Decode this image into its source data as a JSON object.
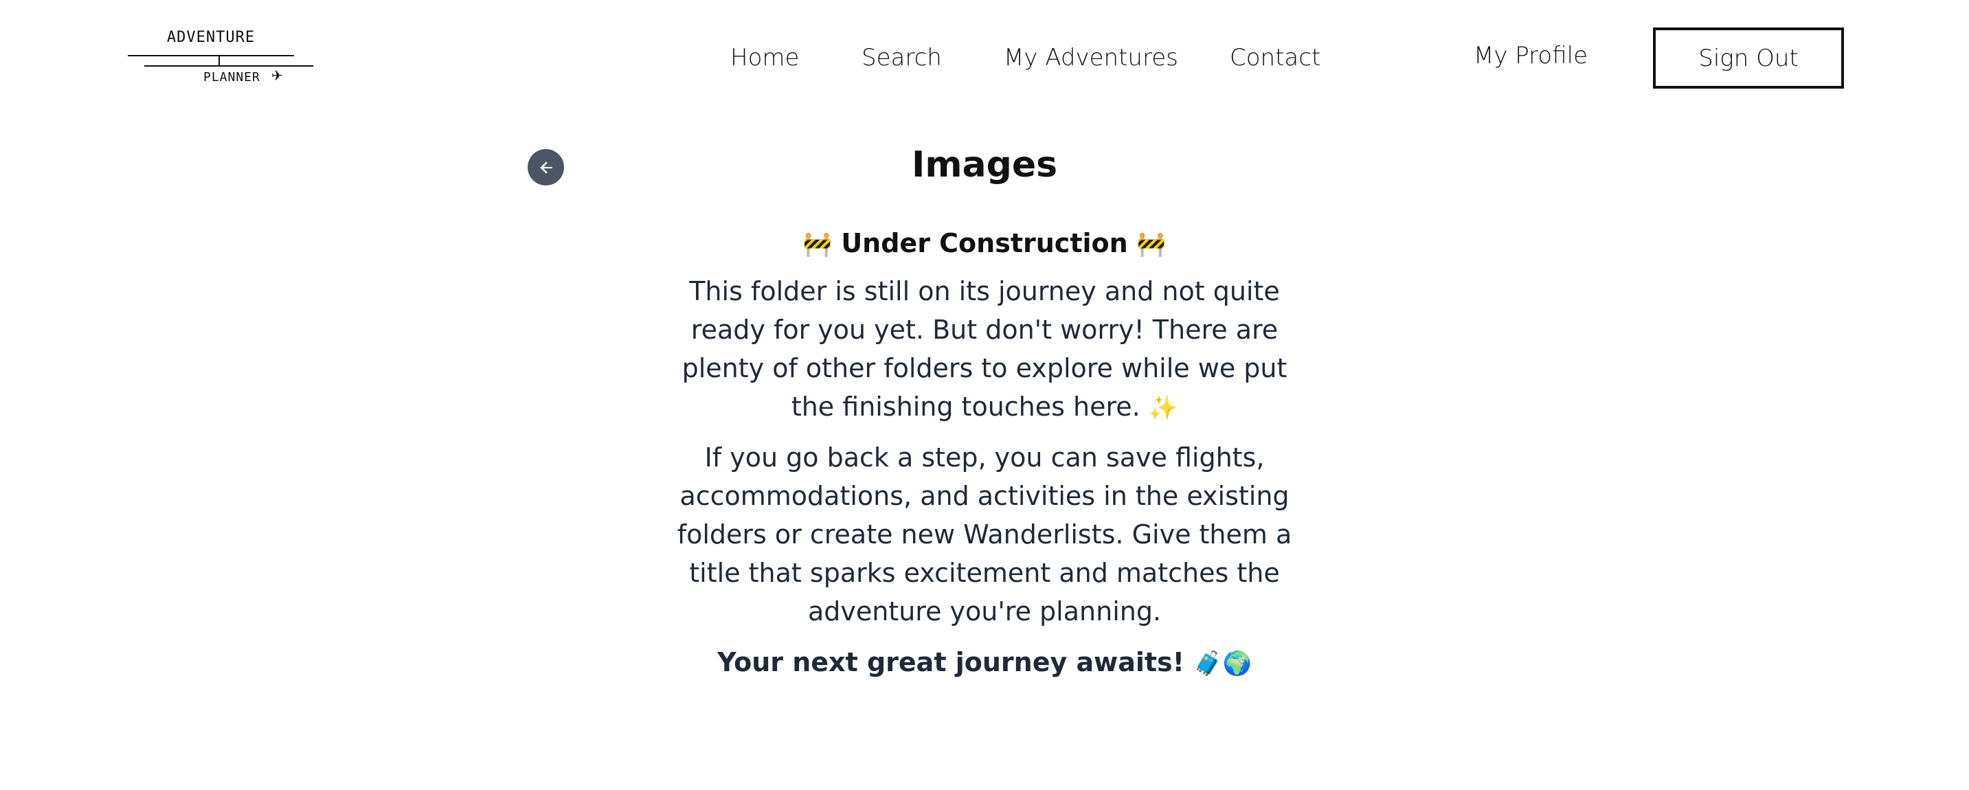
{
  "logo": {
    "top_text": "ADVENTURE",
    "bottom_text": "PLANNER",
    "icon": "airplane-icon"
  },
  "nav": {
    "home": "Home",
    "search": "Search",
    "my_adventures": "My Adventures",
    "contact": "Contact",
    "my_profile": "My Profile",
    "sign_out": "Sign Out"
  },
  "page": {
    "title": "Images",
    "back_icon": "arrow-left-icon",
    "under_construction": {
      "emoji_left": "🚧",
      "title": "Under Construction",
      "emoji_right": "🚧"
    },
    "paragraph1": "This folder is still on its journey and not quite ready for you yet. But don't worry! There are plenty of other folders to explore while we put the finishing touches here.",
    "paragraph1_emoji": "✨",
    "paragraph2": "If you go back a step, you can save flights, accommodations, and activities in the existing folders or create new Wanderlists. Give them a title that sparks excitement and matches the adventure you're planning.",
    "closing": "Your next great journey awaits!",
    "closing_emoji": "🧳🌍"
  },
  "colors": {
    "back_button_bg": "#4b5563",
    "text": "#1f2937",
    "border": "#111111"
  }
}
